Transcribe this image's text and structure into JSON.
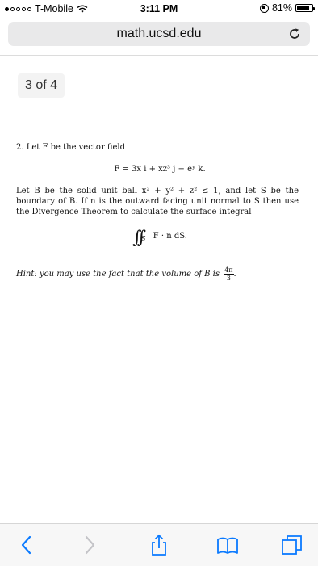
{
  "status_bar": {
    "carrier": "T-Mobile",
    "time": "3:11 PM",
    "battery": "81%",
    "battery_level": 0.81
  },
  "browser": {
    "url": "math.ucsd.edu"
  },
  "pdf": {
    "page_indicator": "3 of 4"
  },
  "problem": {
    "number": "2.",
    "intro": "Let F be the vector field",
    "equation": "F = 3x i + xz³ j − eʸ k.",
    "paragraph": "Let B be the solid unit ball x² + y² + z² ≤ 1, and let S be the boundary of B. If n is the outward facing unit normal to S then use the Divergence Theorem to calculate the surface integral",
    "integrand": "F · n dS.",
    "integral_subscript": "S",
    "hint_text": "Hint: you may use the fact that the volume of B is",
    "hint_num": "4π",
    "hint_den": "3"
  },
  "toolbar": {
    "icons": [
      "back-icon",
      "forward-icon",
      "share-icon",
      "bookmarks-icon",
      "tabs-icon"
    ]
  }
}
